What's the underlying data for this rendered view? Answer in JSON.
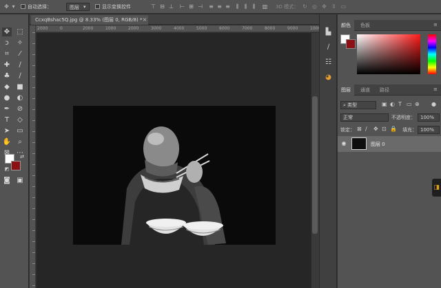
{
  "options_bar": {
    "auto_select_label": "自动选择：",
    "auto_select_value": "图层",
    "show_transform_label": "显示变换控件",
    "mode_3d_label": "3D 模式："
  },
  "document": {
    "tab_title": "CcxqBshac5Q.jpg @ 8.33% (图层 0, RGB/8) *",
    "close_glyph": "×",
    "ruler_h": [
      "2000",
      "0",
      "2000",
      "1000",
      "2000",
      "3000",
      "4000",
      "5000",
      "6000",
      "7000",
      "8000",
      "9000",
      "10000"
    ]
  },
  "panels": {
    "color_tabs": [
      "颜色",
      "色板"
    ],
    "layer_tabs": [
      "图层",
      "通道",
      "路径"
    ],
    "filter_kind": "类型",
    "blend_mode": "正常",
    "opacity_label": "不透明度：",
    "opacity_value": "100%",
    "lock_label": "锁定：",
    "fill_label": "填充：",
    "fill_value": "100%",
    "layer_name": "图层 0"
  },
  "colors": {
    "foreground": "#ffffff",
    "background": "#8c1115",
    "picker_hue": "#ff1a1a"
  },
  "icons": {
    "toolbar": [
      "move-icon",
      "marquee-icon",
      "lasso-icon",
      "magic-wand-icon",
      "crop-icon",
      "eyedropper-icon",
      "healing-icon",
      "brush-icon",
      "stamp-icon",
      "history-brush-icon",
      "eraser-icon",
      "gradient-icon",
      "blur-icon",
      "dodge-icon",
      "pen-icon",
      "type-icon",
      "path-select-icon",
      "rectangle-icon",
      "hand-icon",
      "zoom-icon"
    ],
    "strip": [
      "color-panel-icon",
      "brush-settings-icon",
      "adjust-icon",
      "color-wheel-icon"
    ]
  }
}
